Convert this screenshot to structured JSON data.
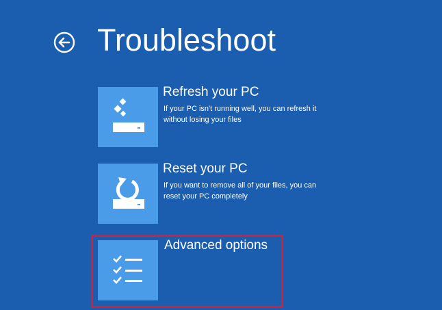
{
  "header": {
    "title": "Troubleshoot",
    "back_icon": "back-arrow-circle-icon"
  },
  "options": [
    {
      "title": "Refresh your PC",
      "description": "If your PC isn't running well, you can refresh it without losing your files",
      "icon": "refresh-pc-icon"
    },
    {
      "title": "Reset your PC",
      "description": "If you want to remove all of your files, you can reset your PC completely",
      "icon": "reset-pc-icon"
    },
    {
      "title": "Advanced options",
      "description": "",
      "icon": "checklist-icon",
      "highlighted": true
    }
  ],
  "colors": {
    "background": "#1b5eaf",
    "tile": "#4a9be8",
    "text": "#ffffff",
    "highlight_border": "#d81e30"
  }
}
